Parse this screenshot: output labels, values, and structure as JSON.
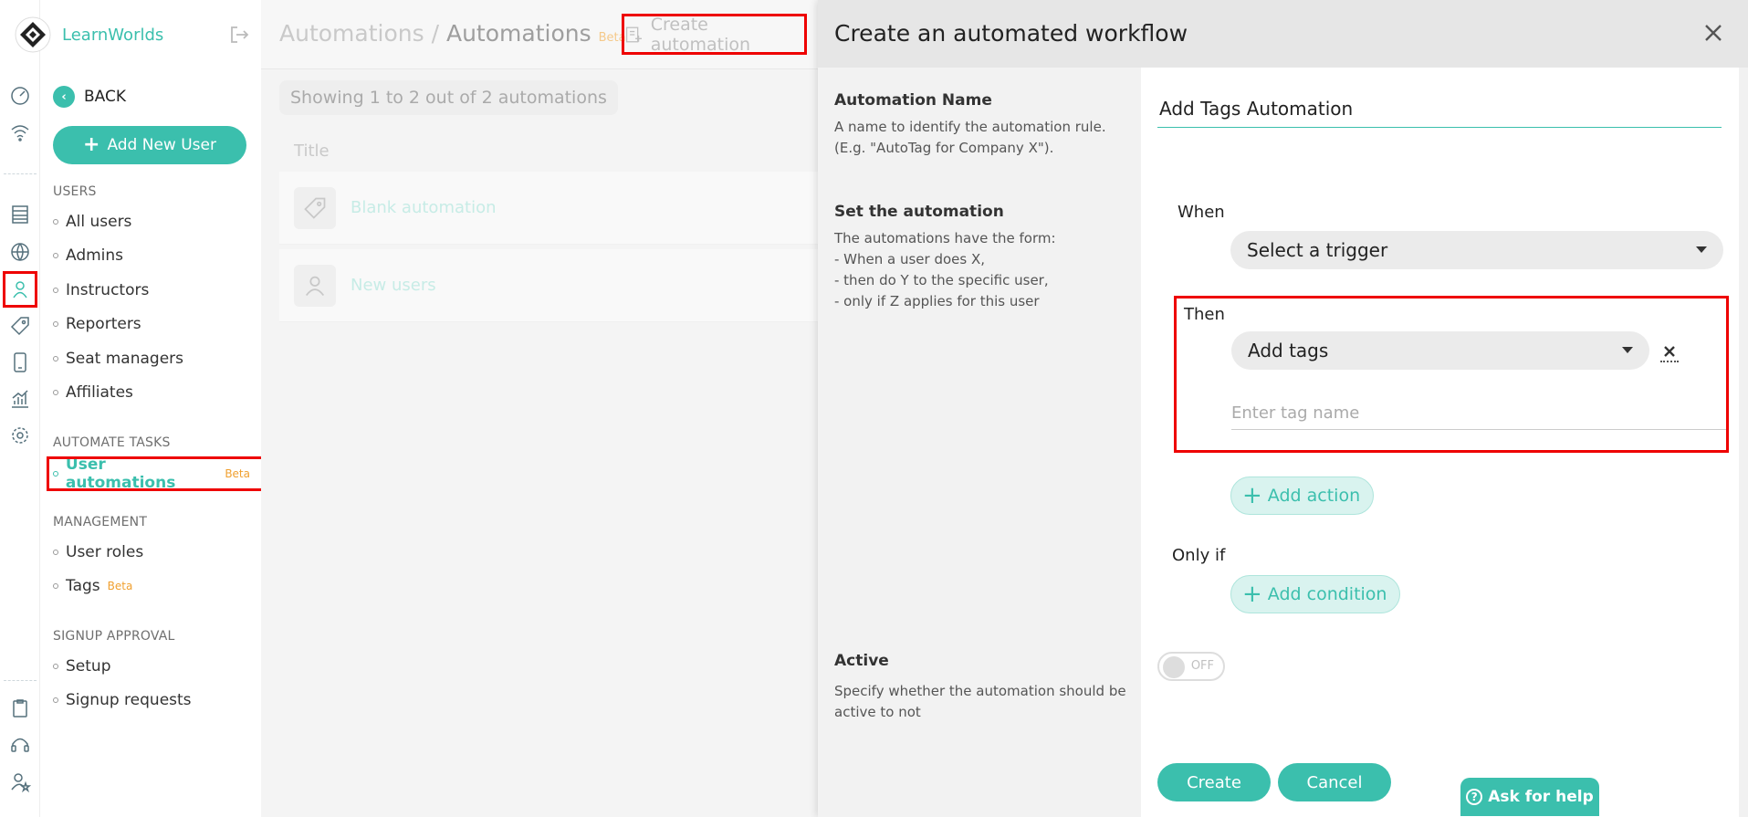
{
  "brand": {
    "name": "LearnWorlds"
  },
  "sidebar": {
    "back_label": "BACK",
    "add_user_label": "Add New User",
    "sections": {
      "users": "USERS",
      "automate": "AUTOMATE TASKS",
      "management": "MANAGEMENT",
      "signup": "SIGNUP APPROVAL"
    },
    "users_items": [
      "All users",
      "Admins",
      "Instructors",
      "Reporters",
      "Seat managers",
      "Affiliates"
    ],
    "automate_item": {
      "label": "User automations",
      "badge": "Beta"
    },
    "management_items": [
      {
        "label": "User roles",
        "badge": ""
      },
      {
        "label": "Tags",
        "badge": "Beta"
      }
    ],
    "signup_items": [
      "Setup",
      "Signup requests"
    ]
  },
  "main": {
    "breadcrumb_first": "Automations",
    "breadcrumb_sep": "/",
    "breadcrumb_current": "Automations",
    "breadcrumb_badge": "Beta",
    "create_label": "Create automation",
    "showing": "Showing 1 to 2 out of 2 automations",
    "column_title": "Title",
    "rows": [
      {
        "label": "Blank automation",
        "icon": "tag-icon"
      },
      {
        "label": "New users",
        "icon": "user-icon"
      }
    ]
  },
  "modal": {
    "title": "Create an automated workflow",
    "name_label": "Automation Name",
    "name_desc": "A name to identify the automation rule. (E.g. \"AutoTag for Company X\").",
    "name_value": "Add Tags Automation",
    "set_label": "Set the automation",
    "set_desc_lines": [
      "The automations have the form:",
      "- When a user does X,",
      "- then do Y to the specific user,",
      "- only if Z applies for this user"
    ],
    "when_label": "When",
    "trigger_value": "Select a trigger",
    "then_label": "Then",
    "action_value": "Add tags",
    "tag_placeholder": "Enter tag name",
    "add_action_label": "Add action",
    "onlyif_label": "Only if",
    "add_condition_label": "Add condition",
    "active_label": "Active",
    "active_desc": "Specify whether the automation should be active to not",
    "toggle_state": "OFF",
    "create_label": "Create",
    "cancel_label": "Cancel",
    "help_label": "Ask for help",
    "help_glyph": "?"
  },
  "colors": {
    "accent": "#3bbfad",
    "highlight": "#e00000",
    "beta": "#f0a030"
  }
}
